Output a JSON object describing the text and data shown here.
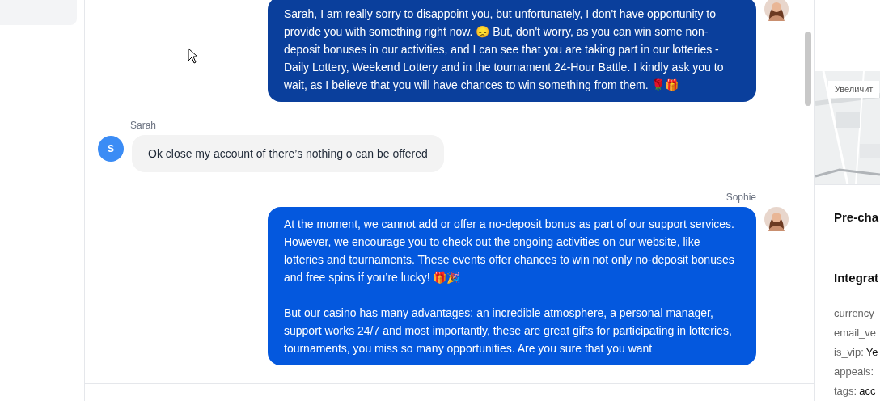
{
  "messages": [
    {
      "kind": "agent",
      "text": "Sarah, I am really sorry to disappoint you, but unfortunately, I don't have opportunity to provide you with something right now. 😞 But, don't worry, as you can win some non-deposit bonuses in our activities, and I can see that you are taking part in our lotteries - Daily Lottery, Weekend Lottery and in the tournament 24-Hour Battle. I kindly ask you to wait, as I believe that you will have chances to win something from them. 🌹🎁",
      "color": "#0a3f9c"
    },
    {
      "kind": "customer",
      "name": "Sarah",
      "initial": "S",
      "text": "Ok close my account of there’s nothing o can be offered"
    },
    {
      "kind": "agent",
      "name": "Sophie",
      "text": "At the moment, we cannot add or offer a no-deposit bonus as part of our support services. However, we encourage you to check out the ongoing activities on our website, like lotteries and tournaments. These events offer chances to win not only no-deposit bonuses and free spins if you’re lucky! 🎁🎉\n\nBut our casino has many advantages: an incredible atmosphere, a personal manager, support works 24/7 and most importantly, these are great gifts for participating in lotteries, tournaments, you miss so many opportunities. Are you sure that you want",
      "color": "#0458de"
    }
  ],
  "side_panel": {
    "map_button": "Увеличит",
    "sections": [
      "Pre-cha",
      "Integrat"
    ],
    "fields": [
      {
        "key": "currency"
      },
      {
        "key": "email_ve"
      },
      {
        "key": "is_vip:",
        "value": "Ye"
      },
      {
        "key": "appeals:"
      },
      {
        "key": "tags:",
        "value": "acc"
      }
    ]
  }
}
